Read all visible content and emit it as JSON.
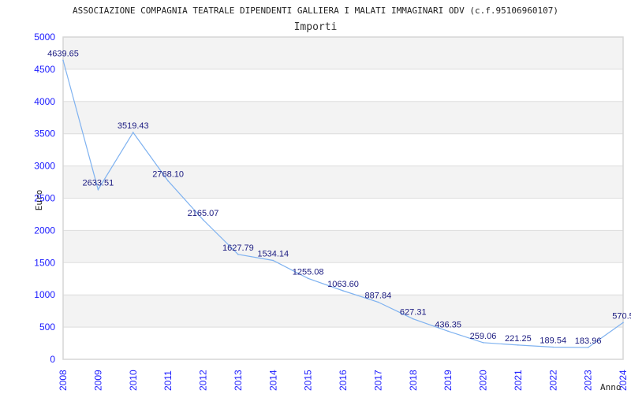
{
  "chart_data": {
    "type": "line",
    "title": "ASSOCIAZIONE COMPAGNIA TEATRALE DIPENDENTI GALLIERA I MALATI IMMAGINARI ODV (c.f.95106960107)",
    "subtitle": "Importi",
    "xlabel": "Anno",
    "ylabel": "Euro",
    "ylim": [
      0,
      5000
    ],
    "yticks": [
      "0",
      "500",
      "1000",
      "1500",
      "2000",
      "2500",
      "3000",
      "3500",
      "4000",
      "4500",
      "5000"
    ],
    "categories": [
      "2008",
      "2009",
      "2010",
      "2011",
      "2012",
      "2013",
      "2014",
      "2015",
      "2016",
      "2017",
      "2018",
      "2019",
      "2020",
      "2021",
      "2022",
      "2023",
      "2024"
    ],
    "values": [
      4639.65,
      2633.51,
      3519.43,
      2768.1,
      2165.07,
      1627.79,
      1534.14,
      1255.08,
      1063.6,
      887.84,
      627.31,
      436.35,
      259.06,
      221.25,
      189.54,
      183.96,
      570.5
    ],
    "data_labels": [
      "4639.65",
      "2633.51",
      "3519.43",
      "2768.10",
      "2165.07",
      "1627.79",
      "1534.14",
      "1255.08",
      "1063.60",
      "887.84",
      "627.31",
      "436.35",
      "259.06",
      "221.25",
      "189.54",
      "183.96",
      "570.5"
    ],
    "grid": true,
    "band_colors": [
      "#f3f3f3",
      "#ffffff"
    ],
    "line_color": "#7fb2f0",
    "legend": "none"
  }
}
